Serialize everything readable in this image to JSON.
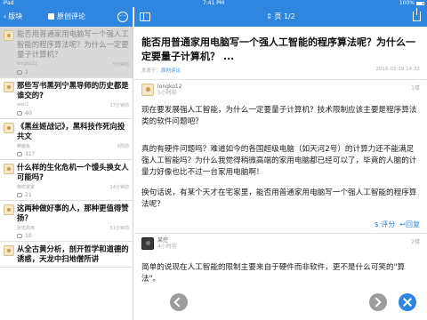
{
  "statusbar": {
    "carrier": "iPad",
    "time": "7:41 PM",
    "battery": "100%"
  },
  "left": {
    "back_label": "版块",
    "title": "原创评论",
    "more": "···",
    "topics": [
      {
        "title": "能否用普通家用电脑写一个强人工智能的程序算法呢？为什么一定要量子计算机？",
        "author": "longko12",
        "time": "5分钟前",
        "count": "2",
        "selected": true
      },
      {
        "title": "那些写书黑列宁黑导师的历史都是谁交的?",
        "author": "wen1",
        "time": "17分钟前",
        "count": "40"
      },
      {
        "title": "《黑丝姬战记》，黑科技作死向投共文",
        "author": "腾鹿兔",
        "time": "6周前",
        "count": "317"
      },
      {
        "title": "什么样的生化危机一个馒头换女人可能吗?",
        "author": "微样家家",
        "time": "14分钟前",
        "count": "21"
      },
      {
        "title": "这两种做好事的人，那种更值得赞扬？",
        "author": "张宏高用",
        "time": "51分钟前",
        "count": "10"
      },
      {
        "title": "从全古黄分析，剖开哲学和道德的诱惑，天龙中扫地僧所讲",
        "author": "",
        "time": "",
        "count": ""
      }
    ]
  },
  "right": {
    "pager": "页 1/2",
    "post": {
      "title": "能否用普通家用电脑写一个强人工智能的程序算法呢？为什么一定要量子计算机？ ...",
      "published": "发表于：",
      "category": "原创评论",
      "date": "2016-03-19 14:32"
    },
    "replies": [
      {
        "author": "longko12",
        "time": "5小时前",
        "floor": "1楼",
        "paragraphs": [
          "现在要发展强人工智能，为什么一定要量子计算机？技术限制应该主要是程序算法类的软件问题吧？",
          "真的有硬件问题吗？难道如今的各国超级电脑（如天河2号）的计算力还不能满足强人工智能吗？为什么我觉得稍微高端的家用电脑都已经可以了，毕竟的人脑的计量力好像也比不过一台家用电脑啊！",
          "换句话说，有某个天才在宅家里，能否用普通家用电脑写一个强人工智能的程序算法呢？"
        ],
        "score": "$ 评分",
        "reply": "回复"
      },
      {
        "author": "某控",
        "time": "4小时前",
        "floor": "2楼",
        "paragraphs": [
          "简单的说现在人工智能的限制主要来自于硬件而非软件，更不是什么可笑的\"算法\"。"
        ]
      }
    ]
  }
}
